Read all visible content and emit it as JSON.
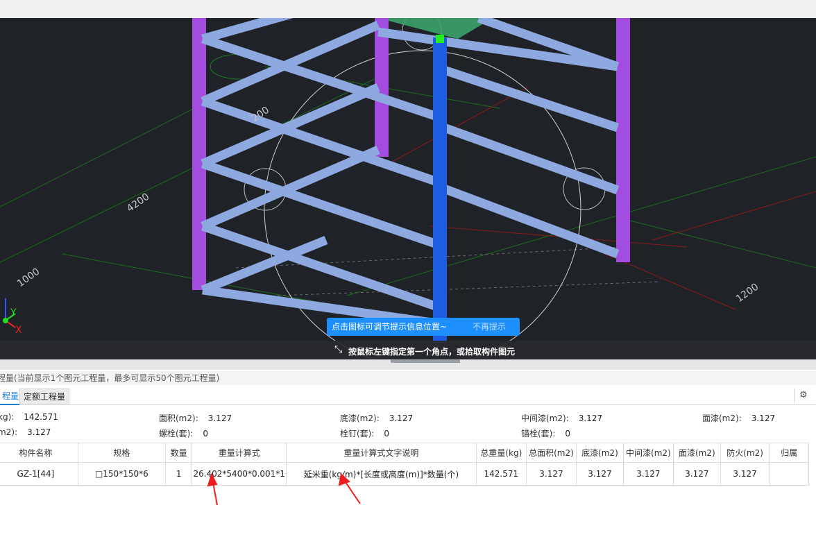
{
  "viewport": {
    "dimensions": [
      "200",
      "4200",
      "1000",
      "1200"
    ],
    "axis_y": "Y",
    "axis_x": "X",
    "colors": {
      "background": "#1f2227",
      "column_purple": "#a24de0",
      "beam_blue": "#8ea8e0",
      "column_selected": "#1f5de0",
      "grid_red": "#8b1a1a",
      "grid_green": "#1c6b1c"
    }
  },
  "tip": {
    "text": "点击图标可调节提示信息位置~",
    "dismiss": "不再提示"
  },
  "status": {
    "cursor_icon": "crosshair-arrows-icon",
    "text": "按鼠标左键指定第一个角点，或拾取构件图元"
  },
  "panel": {
    "title": "程量(当前显示1个图元工程量，最多可显示50个图元工程量)",
    "tabs": [
      "程量",
      "定额工程量"
    ],
    "settings_icon": "settings-icon"
  },
  "summary": {
    "row1": [
      {
        "label": "kg):",
        "value": "142.571"
      },
      {
        "label": "面积(m2):",
        "value": "3.127"
      },
      {
        "label": "底漆(m2):",
        "value": "3.127"
      },
      {
        "label": "中间漆(m2):",
        "value": "3.127"
      },
      {
        "label": "面漆(m2):",
        "value": "3.127"
      }
    ],
    "row2": [
      {
        "label": "m2):",
        "value": "3.127"
      },
      {
        "label": "螺栓(套):",
        "value": "0"
      },
      {
        "label": "栓钉(套):",
        "value": "0"
      },
      {
        "label": "锚栓(套):",
        "value": "0"
      }
    ]
  },
  "table": {
    "headers": [
      "构件名称",
      "规格",
      "数量",
      "重量计算式",
      "重量计算式文字说明",
      "总重量(kg)",
      "总面积(m2)",
      "底漆(m2)",
      "中间漆(m2)",
      "面漆(m2)",
      "防火(m2)",
      "归属"
    ],
    "rows": [
      [
        "GZ-1[44]",
        "□150*150*6",
        "1",
        "26.402*5400*0.001*1",
        "延米重(kg/m)*[长度或高度(m)]*数量(个)",
        "142.571",
        "3.127",
        "3.127",
        "3.127",
        "3.127",
        "3.127",
        ""
      ]
    ]
  },
  "annotations": {
    "arrow_color": "#ee1c1c"
  }
}
